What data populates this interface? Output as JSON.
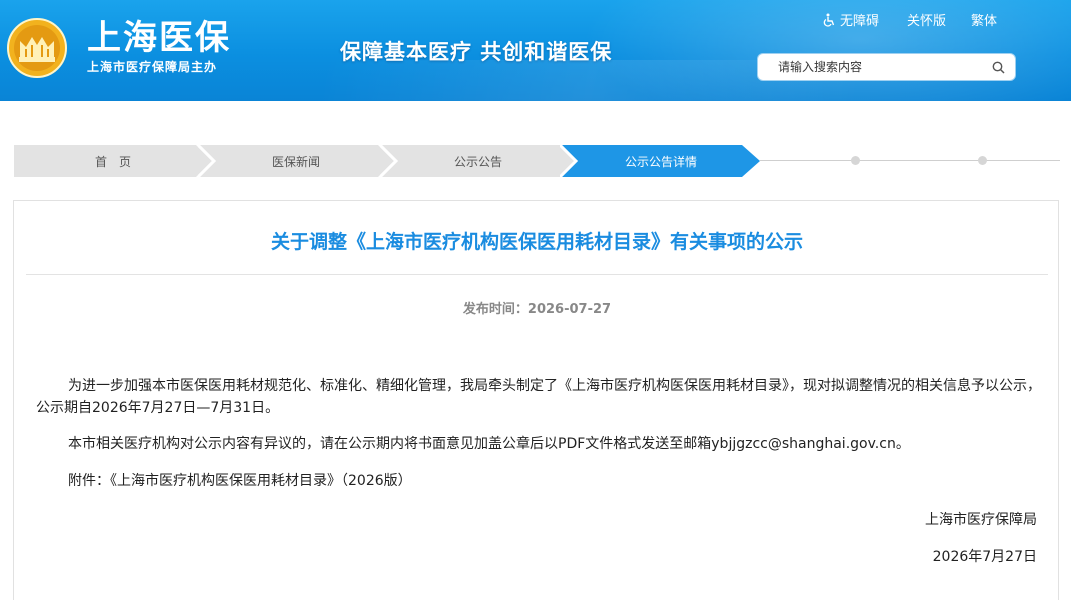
{
  "header": {
    "brand_name": "上海医保",
    "brand_sub": "上海市医疗保障局主办",
    "slogan": "保障基本医疗  共创和谐医保",
    "links": [
      {
        "label": "无障碍",
        "icon": "wheelchair-icon"
      },
      {
        "label": "关怀版"
      },
      {
        "label": "繁体"
      }
    ],
    "search": {
      "placeholder": "请输入搜索内容",
      "icon": "search-icon"
    }
  },
  "breadcrumb": [
    {
      "label": "首　页",
      "active": false
    },
    {
      "label": "医保新闻",
      "active": false
    },
    {
      "label": "公示公告",
      "active": false
    },
    {
      "label": "公示公告详情",
      "active": true
    }
  ],
  "colors": {
    "accent": "#1a8ce0",
    "crumb_active": "#1e96e6",
    "crumb_inactive": "#e3e3e3",
    "header": "#0b8fe0"
  },
  "article": {
    "title": "关于调整《上海市医疗机构医保医用耗材目录》有关事项的公示",
    "meta": "发布时间：2026-07-27",
    "paragraphs": [
      "为进一步加强本市医保医用耗材规范化、标准化、精细化管理，我局牵头制定了《上海市医疗机构医保医用耗材目录》，现对拟调整情况的相关信息予以公示，公示期自2026年7月27日—7月31日。",
      "本市相关医疗机构对公示内容有异议的，请在公示期内将书面意见加盖公章后以PDF文件格式发送至邮箱ybjjgzcc@shanghai.gov.cn。",
      "附件：《上海市医疗机构医保医用耗材目录》（2026版）"
    ],
    "signature": "上海市医疗保障局",
    "date": "2026年7月27日"
  }
}
